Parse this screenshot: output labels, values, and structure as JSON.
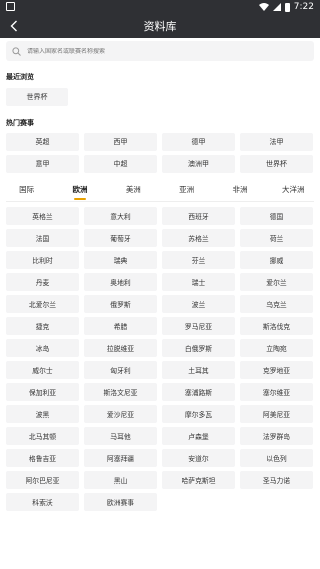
{
  "status": {
    "time": "7:22"
  },
  "header": {
    "title": "资料库",
    "back_icon": "chevron-left-icon"
  },
  "search": {
    "placeholder": "请输入国家名或联赛名称搜索"
  },
  "recent": {
    "title": "最近浏览",
    "items": [
      "世界杯"
    ]
  },
  "hot": {
    "title": "热门赛事",
    "items": [
      "英超",
      "西甲",
      "德甲",
      "法甲",
      "意甲",
      "中超",
      "澳洲甲",
      "世界杯"
    ]
  },
  "tabs": {
    "items": [
      "国际",
      "欧洲",
      "美洲",
      "亚洲",
      "非洲",
      "大洋洲"
    ],
    "active": "欧洲",
    "accent_color": "#e8a100"
  },
  "countries": [
    "英格兰",
    "意大利",
    "西班牙",
    "德国",
    "法国",
    "葡萄牙",
    "苏格兰",
    "荷兰",
    "比利时",
    "瑞典",
    "芬兰",
    "挪威",
    "丹麦",
    "奥地利",
    "瑞士",
    "爱尔兰",
    "北爱尔兰",
    "俄罗斯",
    "波兰",
    "乌克兰",
    "捷克",
    "希腊",
    "罗马尼亚",
    "斯洛伐克",
    "冰岛",
    "拉脱维亚",
    "白俄罗斯",
    "立陶宛",
    "威尔士",
    "匈牙利",
    "土耳其",
    "克罗地亚",
    "保加利亚",
    "斯洛文尼亚",
    "塞浦路斯",
    "塞尔维亚",
    "波黑",
    "爱沙尼亚",
    "摩尔多瓦",
    "阿美尼亚",
    "北马其顿",
    "马耳他",
    "卢森堡",
    "法罗群岛",
    "格鲁吉亚",
    "阿塞拜疆",
    "安道尔",
    "以色列",
    "阿尔巴尼亚",
    "黑山",
    "哈萨克斯坦",
    "圣马力诺",
    "科索沃",
    "欧洲赛事"
  ]
}
